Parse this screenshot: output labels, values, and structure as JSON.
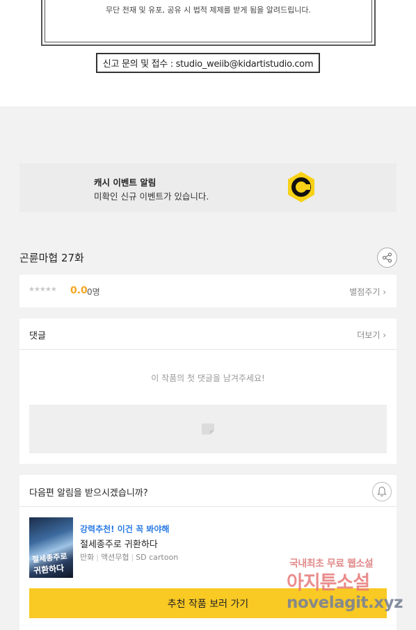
{
  "notice": {
    "line1": "",
    "line2": "무단 전재 및 유포, 공유 시 법적 제제를 받게 됨을 알려드립니다.",
    "report": "신고 문의 및 접수 : studio_weiib@kidartistudio.com"
  },
  "cash_event": {
    "title": "캐시 이벤트 알림",
    "subtitle": "미확인 신규 이벤트가 있습니다.",
    "coin_letter": "C",
    "coin_color": "#f7d117"
  },
  "episode": {
    "title": "곤륜마협 27화",
    "share_icon": "share-icon"
  },
  "rating": {
    "stars": "★★★★★",
    "score": "0.0",
    "count": "0명",
    "rate_link": "별점주기 ›"
  },
  "comments": {
    "label": "댓글",
    "more": "더보기 ›",
    "empty_message": "이 작품의 첫 댓글을 남겨주세요!"
  },
  "next_episode": {
    "question": "다음편 알림을 받으시겠습니까?",
    "bell_icon": "bell-icon",
    "recommend_tag": "강력추천! 이건 꼭 봐야해",
    "recommend_title": "절세종주로 귀환하다",
    "meta": [
      "만화",
      "액션무협",
      "SD cartoon"
    ],
    "thumb_text1": "절세종주로",
    "thumb_text2": "귀환하다",
    "cta": "추천 작품 보러 가기",
    "cta_color": "#f9c924"
  },
  "watermark": {
    "line1": "국내최초 무료 웹소설",
    "line2": "아지툰소설",
    "line3": "novelagit.xyz"
  }
}
